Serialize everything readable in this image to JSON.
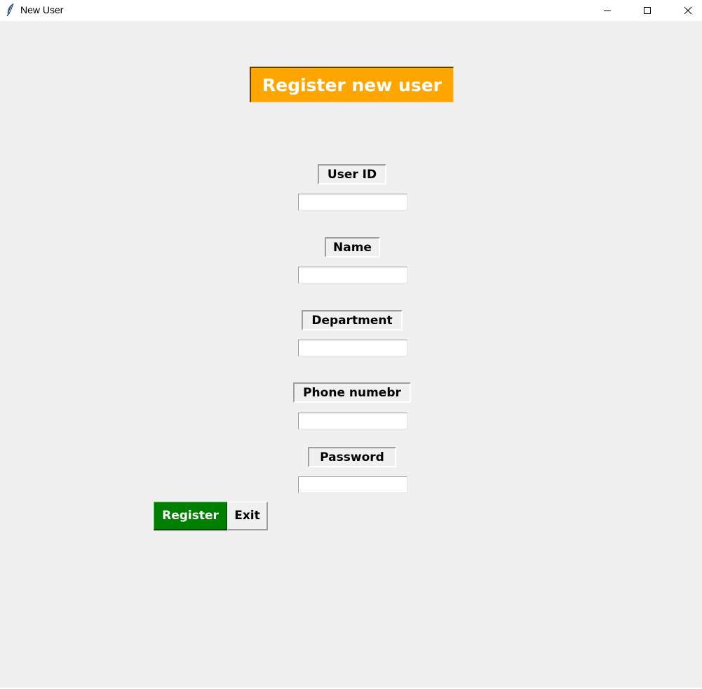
{
  "window": {
    "title": "New User",
    "app_icon": "feather-icon",
    "controls": {
      "minimize_icon": "minimize-icon",
      "maximize_icon": "maximize-icon",
      "close_icon": "close-icon"
    }
  },
  "form": {
    "heading": "Register new user",
    "heading_color": "#ffa500",
    "fields": [
      {
        "label": "User ID",
        "value": ""
      },
      {
        "label": "Name",
        "value": ""
      },
      {
        "label": "Department",
        "value": ""
      },
      {
        "label": "Phone numebr",
        "value": ""
      },
      {
        "label": "Password",
        "value": ""
      }
    ]
  },
  "buttons": {
    "register_label": "Register",
    "register_color": "#008000",
    "exit_label": "Exit"
  }
}
